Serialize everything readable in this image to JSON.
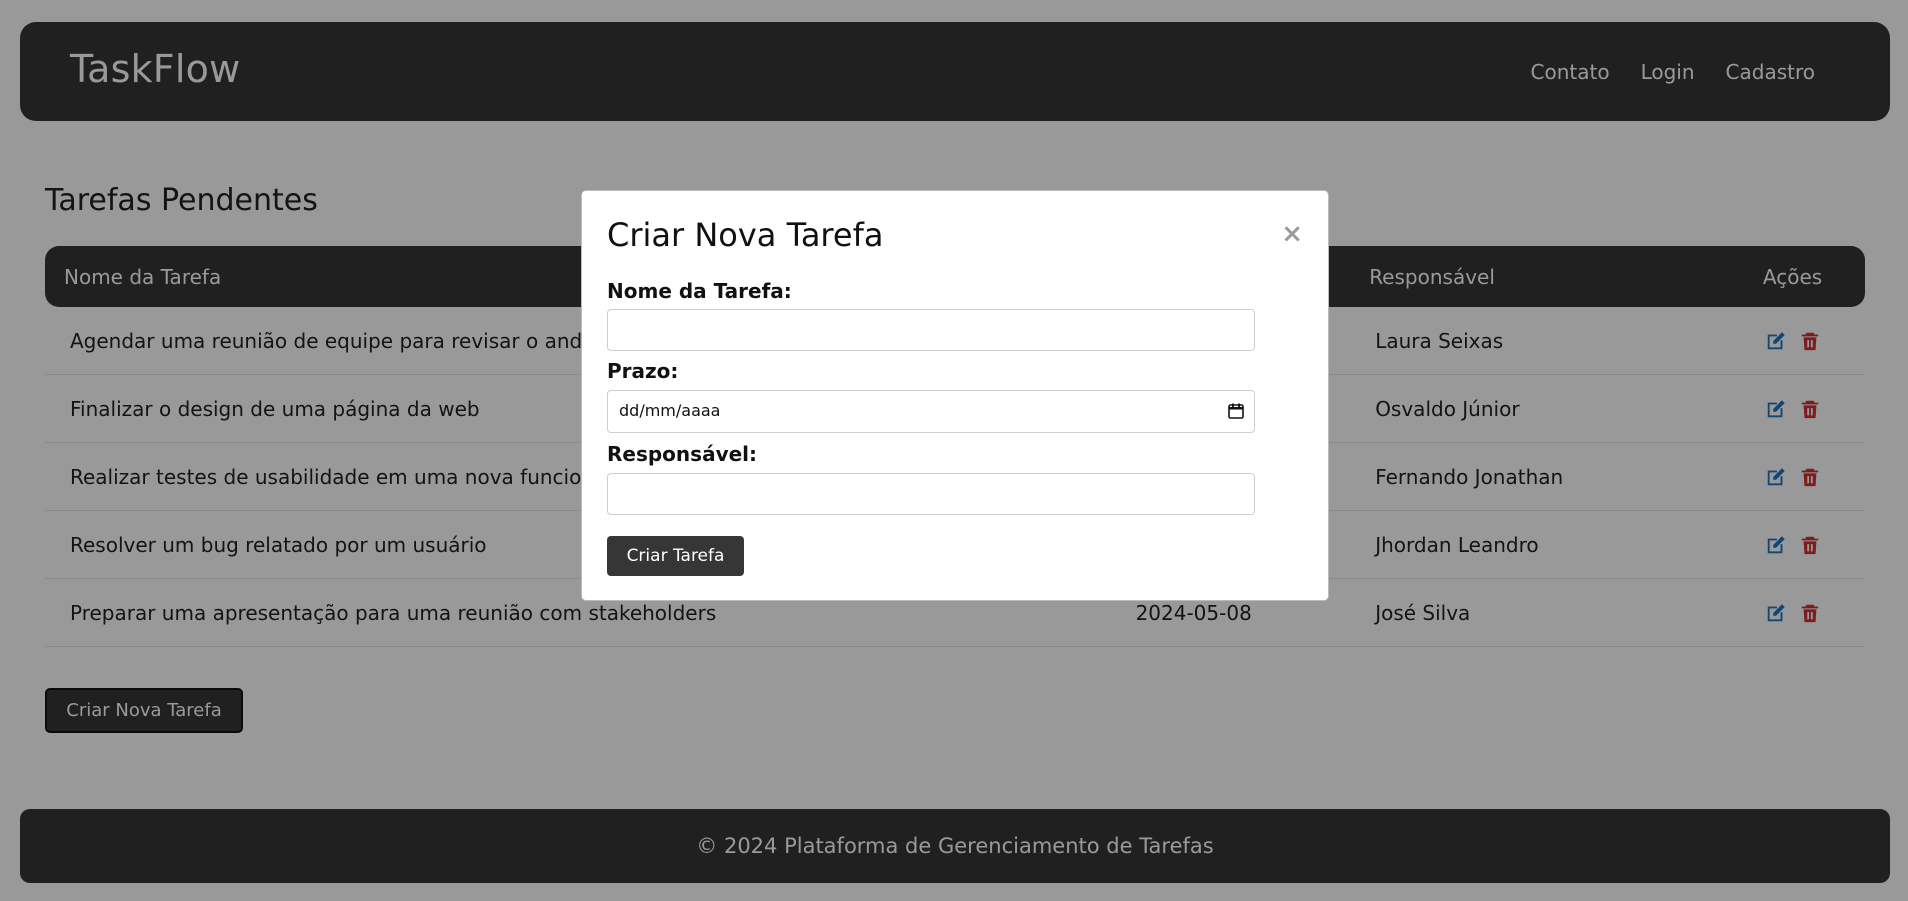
{
  "header": {
    "brand": "TaskFlow",
    "links": [
      {
        "label": "Contato"
      },
      {
        "label": "Login"
      },
      {
        "label": "Cadastro"
      }
    ]
  },
  "main": {
    "title": "Tarefas Pendentes",
    "table": {
      "columns": [
        "Nome da Tarefa",
        "",
        "Responsável",
        "Ações"
      ],
      "rows": [
        {
          "name": "Agendar uma reunião de equipe para revisar o andamento do projeto",
          "deadline": "",
          "assignee": "Laura Seixas"
        },
        {
          "name": "Finalizar o design de uma página da web",
          "deadline": "",
          "assignee": "Osvaldo Júnior"
        },
        {
          "name": "Realizar testes de usabilidade em uma nova funcionalidade",
          "deadline": "",
          "assignee": "Fernando Jonathan"
        },
        {
          "name": "Resolver um bug relatado por um usuário",
          "deadline": "",
          "assignee": "Jhordan Leandro"
        },
        {
          "name": "Preparar uma apresentação para uma reunião com stakeholders",
          "deadline": "2024-05-08",
          "assignee": "José Silva"
        }
      ]
    },
    "create_button": "Criar Nova Tarefa"
  },
  "modal": {
    "title": "Criar Nova Tarefa",
    "close_symbol": "×",
    "fields": {
      "task_name_label": "Nome da Tarefa:",
      "task_name_value": "",
      "deadline_label": "Prazo:",
      "deadline_placeholder": "dd/mm/aaaa",
      "assignee_label": "Responsável:",
      "assignee_value": ""
    },
    "submit_label": "Criar Tarefa"
  },
  "footer": {
    "text": "© 2024 Plataforma de Gerenciamento de Tarefas"
  },
  "colors": {
    "header_bg": "#363636",
    "overlay": "rgba(0,0,0,0.4)",
    "edit_icon": "#1d73bf",
    "delete_icon": "#cf2f2f",
    "close_icon": "#9b9b9b"
  },
  "icons": {
    "edit": "edit-icon",
    "delete": "trash-icon",
    "calendar": "calendar-icon",
    "close": "close-icon"
  }
}
